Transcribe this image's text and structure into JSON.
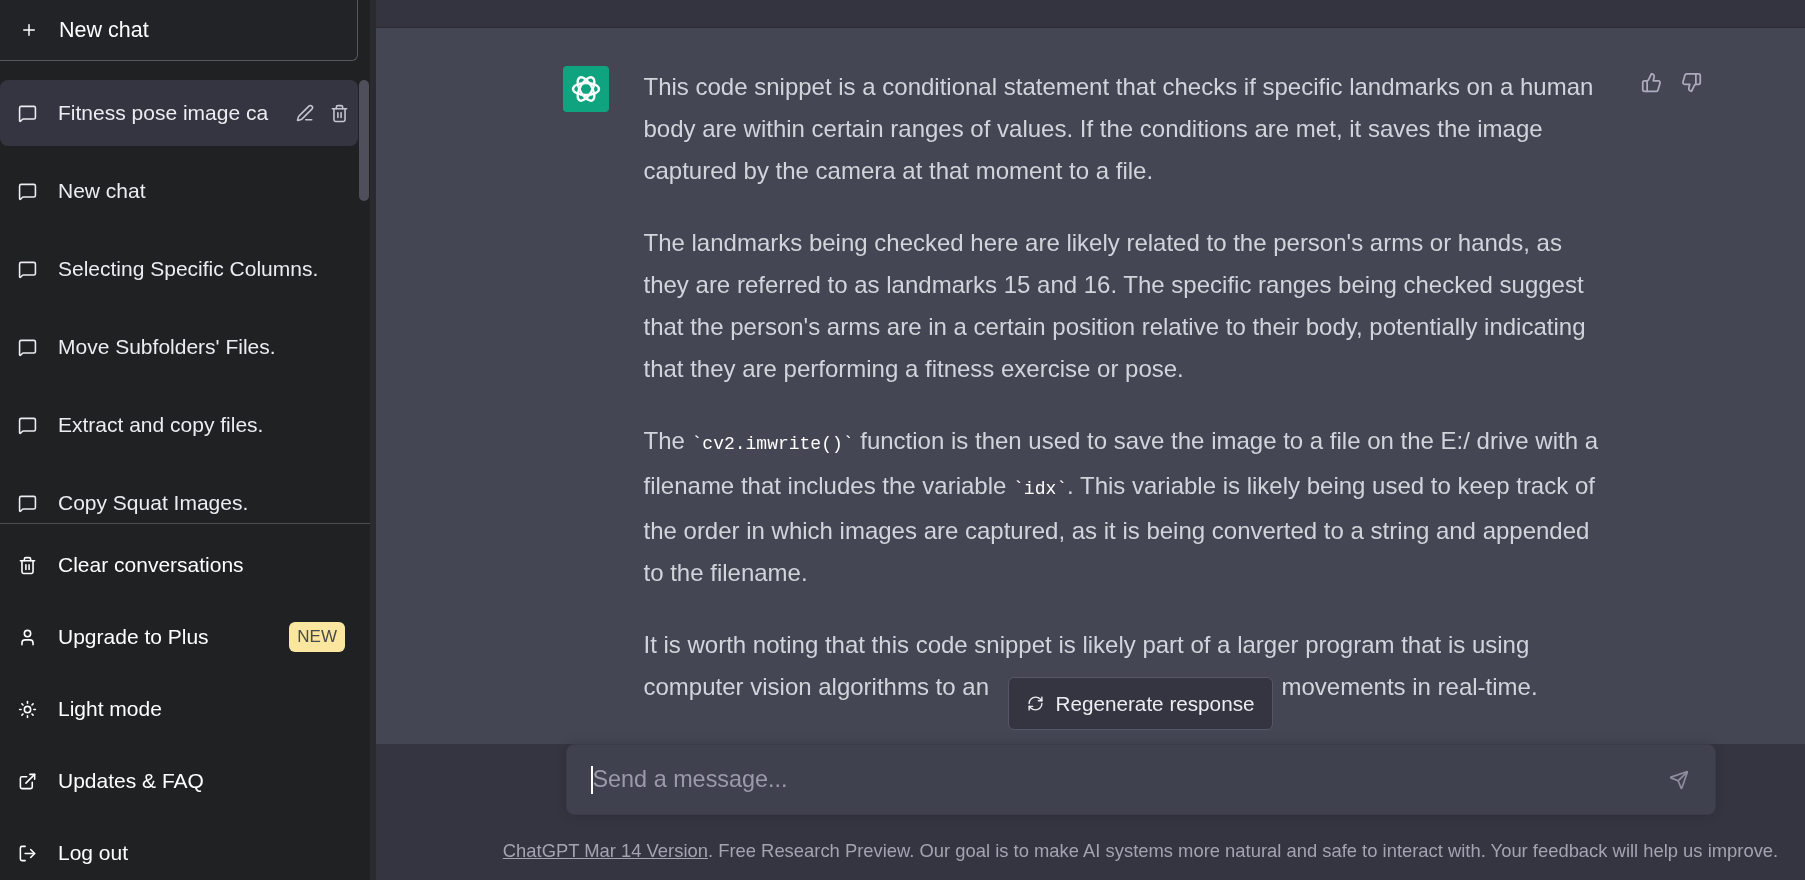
{
  "sidebar": {
    "new_chat_button": {
      "label": "New chat"
    },
    "history": [
      {
        "title": "Fitness pose image ca",
        "selected": true
      },
      {
        "title": "New chat",
        "selected": false
      },
      {
        "title": "Selecting Specific Columns.",
        "selected": false
      },
      {
        "title": "Move Subfolders' Files.",
        "selected": false
      },
      {
        "title": "Extract and copy files.",
        "selected": false
      },
      {
        "title": "Copy Squat Images.",
        "selected": false
      }
    ],
    "menu": [
      {
        "kind": "clear",
        "label": "Clear conversations"
      },
      {
        "kind": "upgrade",
        "label": "Upgrade to Plus",
        "badge": "NEW"
      },
      {
        "kind": "theme",
        "label": "Light mode"
      },
      {
        "kind": "link",
        "label": "Updates & FAQ"
      },
      {
        "kind": "logout",
        "label": "Log out"
      }
    ]
  },
  "message": {
    "paragraphs": [
      {
        "segments": [
          {
            "kind": "text",
            "text": "This code snippet is a conditional statement that checks if specific landmarks on a human body are within certain ranges of values. If the conditions are met, it saves the image captured by the camera at that moment to a file."
          }
        ]
      },
      {
        "segments": [
          {
            "kind": "text",
            "text": "The landmarks being checked here are likely related to the person's arms or hands, as they are referred to as landmarks 15 and 16. The specific ranges being checked suggest that the person's arms are in a certain position relative to their body, potentially indicating that they are performing a fitness exercise or pose."
          }
        ]
      },
      {
        "segments": [
          {
            "kind": "text",
            "text": "The "
          },
          {
            "kind": "code",
            "text": "`cv2.imwrite()`"
          },
          {
            "kind": "text",
            "text": " function is then used to save the image to a file on the E:/ drive with a filename that includes the variable "
          },
          {
            "kind": "code",
            "text": "`idx`"
          },
          {
            "kind": "text",
            "text": ". This variable is likely being used to keep track of the order in which images are captured, as it is being converted to a string and appended to the filename."
          }
        ]
      }
    ],
    "covered_paragraph": {
      "line_1": "It is worth noting that this code snippet is likely part of a larger program that is using",
      "line_2_start": "computer vision algorithms to an",
      "line_2_end": "movements in real-time."
    }
  },
  "regenerate_button": {
    "label": "Regenerate response"
  },
  "composer": {
    "placeholder": "Send a message..."
  },
  "footer": {
    "link": "ChatGPT Mar 14 Version",
    "text": ". Free Research Preview. Our goal is to make AI systems more natural and safe to interact with. Your feedback will help us improve."
  }
}
